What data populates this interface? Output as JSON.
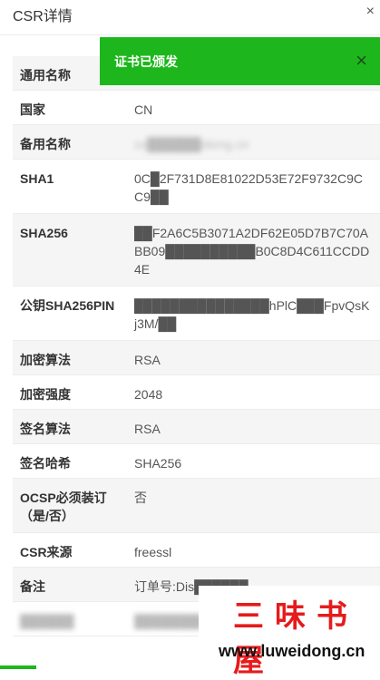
{
  "header": {
    "title": "CSR详情",
    "close": "×"
  },
  "toast": {
    "message": "证书已颁发",
    "close": "×"
  },
  "rows": [
    {
      "label": "通用名称",
      "value": ""
    },
    {
      "label": "国家",
      "value": "CN"
    },
    {
      "label": "备用名称",
      "value": "xx██████idong.cn"
    },
    {
      "label": "SHA1",
      "value": "0C█2F731D8E81022D53E72F9732C9CC9██"
    },
    {
      "label": "SHA256",
      "value": "██F2A6C5B3071A2DF62E05D7B7C70ABB09██████████B0C8D4C611CCDD4E"
    },
    {
      "label": "公钥SHA256PIN",
      "value": "███████████████hPlC███FpvQsKj3M/██"
    },
    {
      "label": "加密算法",
      "value": "RSA"
    },
    {
      "label": "加密强度",
      "value": "2048"
    },
    {
      "label": "签名算法",
      "value": "RSA"
    },
    {
      "label": "签名哈希",
      "value": "SHA256"
    },
    {
      "label": "OCSP必须装订（是/否）",
      "value": "否"
    },
    {
      "label": "CSR来源",
      "value": "freessl"
    },
    {
      "label": "备注",
      "value": "订单号:Dis██████"
    },
    {
      "label": "██████",
      "value": "██████████"
    }
  ],
  "watermark": {
    "text": "三味书屋",
    "url": "www.luweidong.cn"
  }
}
